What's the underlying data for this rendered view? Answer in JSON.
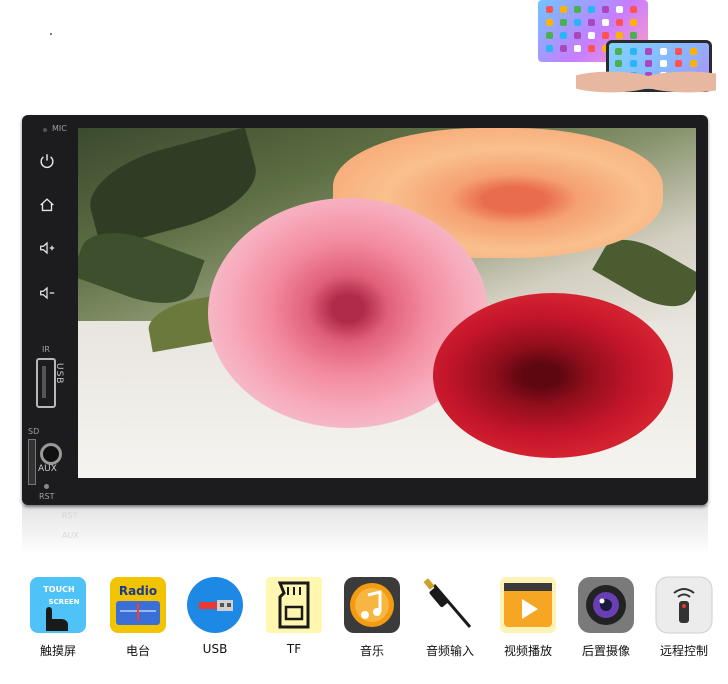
{
  "device": {
    "mic_label": "MIC",
    "ir_label": "IR",
    "usb_port_label": "USB",
    "sd_label": "SD",
    "aux_label": "AUX",
    "rst_label": "RST"
  },
  "reflection": {
    "line1": "RST",
    "line2": "AUX"
  },
  "features": [
    {
      "icon": "touch-screen-icon",
      "icon_text": "TOUCH SCREEN",
      "label": "触摸屏"
    },
    {
      "icon": "radio-icon",
      "icon_text": "Radio",
      "label": "电台"
    },
    {
      "icon": "usb-icon",
      "label": "USB"
    },
    {
      "icon": "tf-card-icon",
      "label": "TF"
    },
    {
      "icon": "music-icon",
      "label": "音乐"
    },
    {
      "icon": "audio-input-icon",
      "label": "音频输入"
    },
    {
      "icon": "video-play-icon",
      "label": "视频播放"
    },
    {
      "icon": "rear-camera-icon",
      "label": "后置摄像"
    },
    {
      "icon": "remote-control-icon",
      "label": "远程控制"
    }
  ],
  "colors": {
    "bezel": "#1c1c1e",
    "usb_blue": "#1e88e5",
    "radio_yellow": "#f2c400",
    "music_orange": "#f39c12",
    "video_orange": "#f5a623"
  }
}
